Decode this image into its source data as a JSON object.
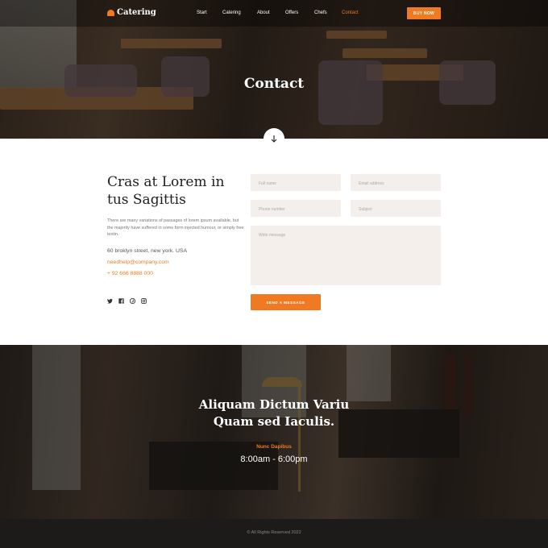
{
  "brand": {
    "name": "Catering",
    "accent": "#f07a21"
  },
  "nav": {
    "items": [
      "Start",
      "Catering",
      "About",
      "Offers",
      "Chefs",
      "Contact"
    ],
    "active": "Contact",
    "buy_label": "BUY NOW"
  },
  "hero": {
    "title": "Contact",
    "scroll_icon": "arrow-down-icon"
  },
  "contact": {
    "heading_line1": "Cras at Lorem in",
    "heading_line2": "tus Sagittis",
    "description": "There are many variations of passages of lorem ipsum available, but the majority have suffered in some form injected humour, or simply free textin.",
    "address": "60 broklyn street, new york. USA",
    "email": "needhelp@company.com",
    "phone": "+ 92 666 8888 000",
    "socials": [
      "twitter-icon",
      "facebook-icon",
      "pinterest-icon",
      "instagram-icon"
    ]
  },
  "form": {
    "full_name_placeholder": "Full name",
    "email_placeholder": "Email address",
    "phone_placeholder": "Phone number",
    "subject_placeholder": "Subject",
    "message_placeholder": "Write message",
    "send_label": "SEND A MESSAGE"
  },
  "hours": {
    "title_line1": "Aliquam Dictum Variu",
    "title_line2": "Quam sed Iaculis.",
    "label": "Nunc Dapibus",
    "time": "8:00am - 6:00pm"
  },
  "footer": {
    "copyright": "© All Rights Reserved 2022"
  }
}
